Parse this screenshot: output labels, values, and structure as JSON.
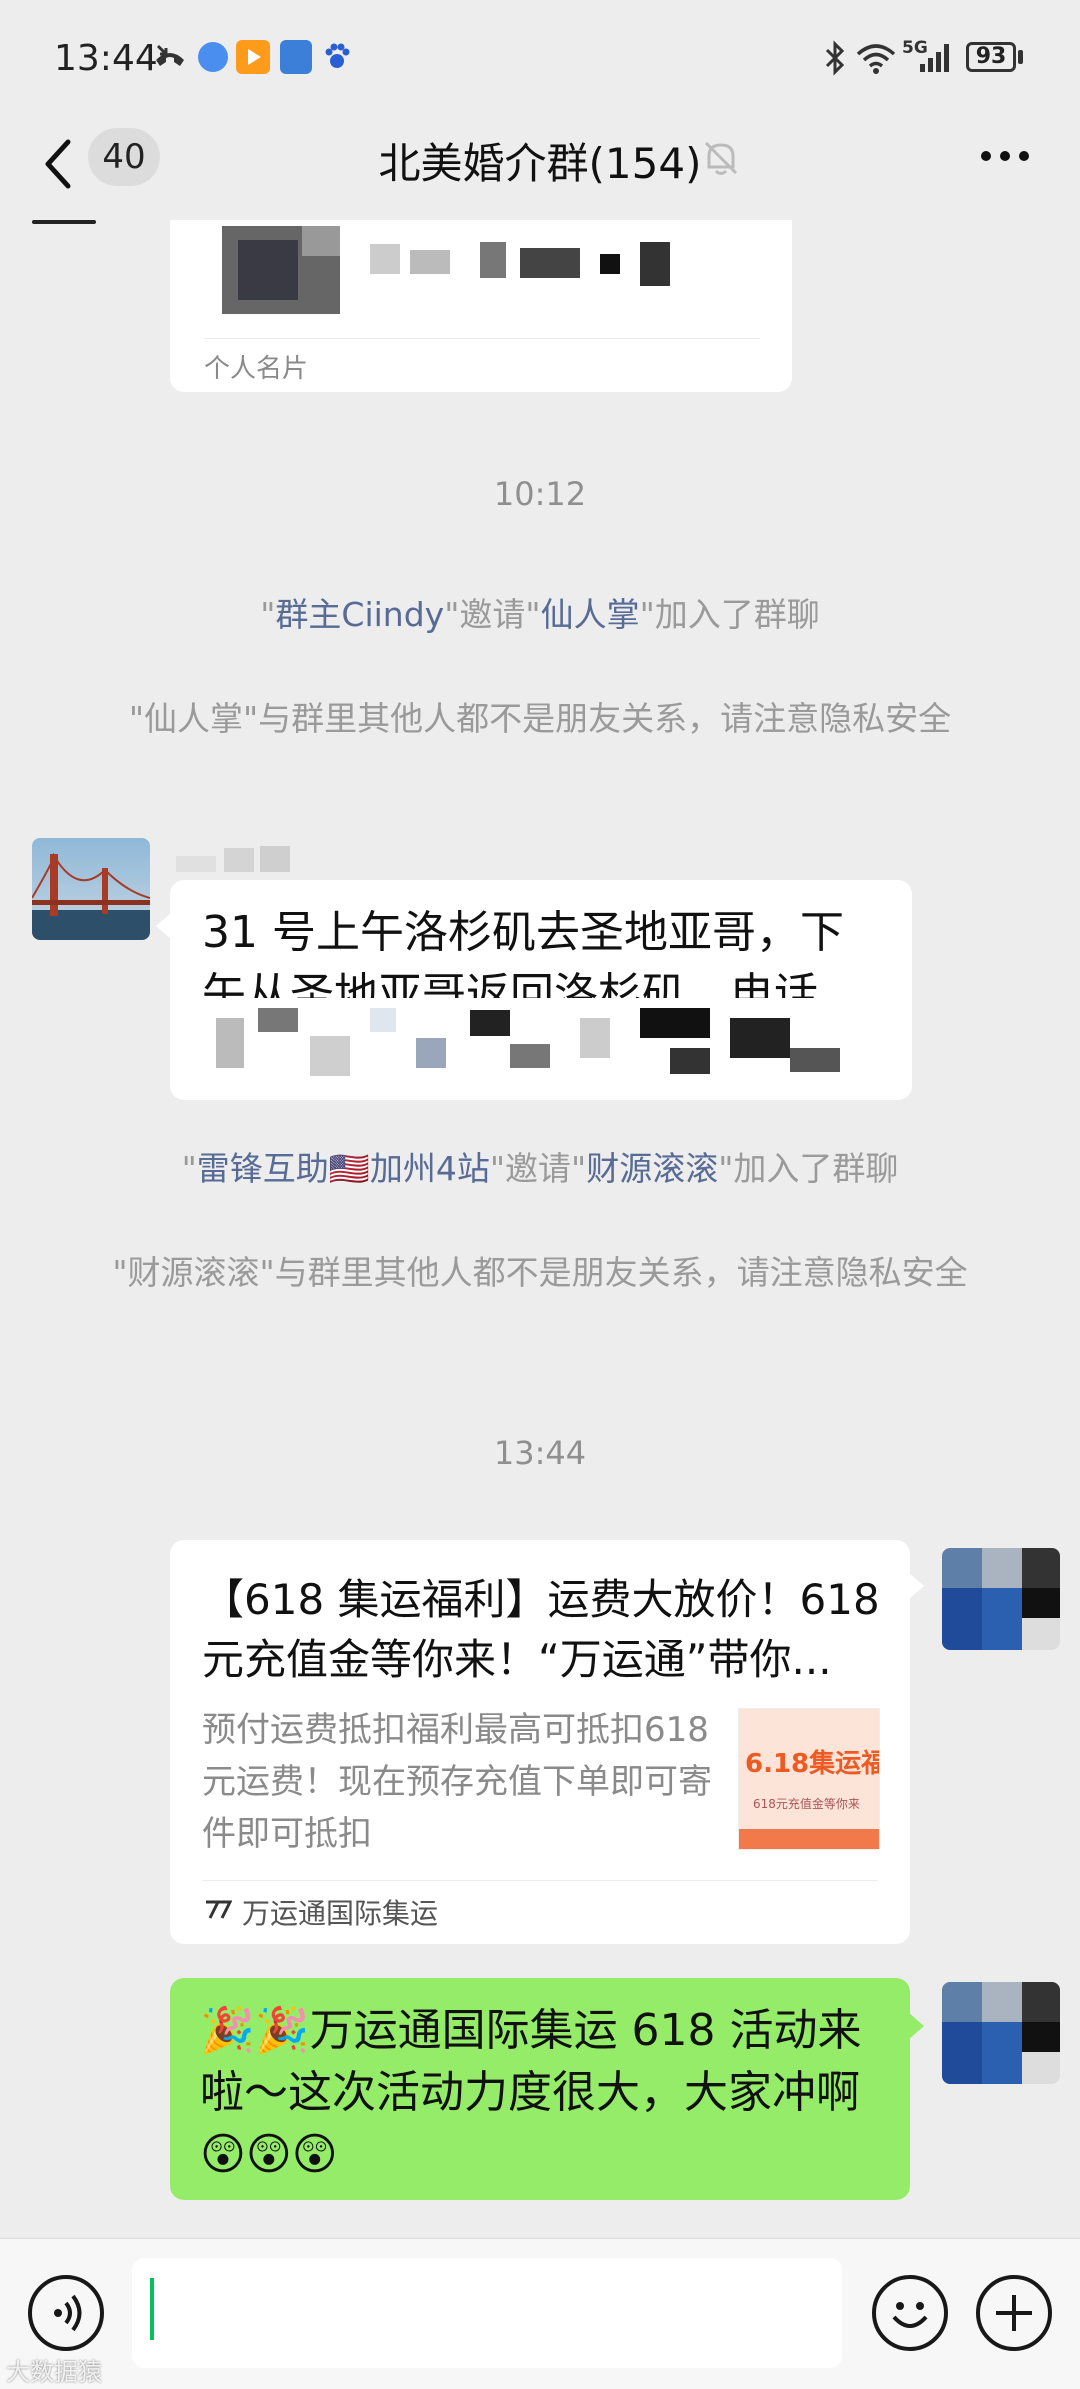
{
  "status_bar": {
    "time": "13:44",
    "network": "5G",
    "battery": "93"
  },
  "nav": {
    "unread_count": "40",
    "title": "北美婚介群(154)"
  },
  "card": {
    "label": "个人名片"
  },
  "timestamps": [
    "10:12",
    "13:44"
  ],
  "system_messages": [
    {
      "q1": "\"",
      "inviter": "群主Ciindy",
      "mid": "\"邀请\"",
      "invitee": "仙人掌",
      "end": "\"加入了群聊"
    },
    {
      "text": "\"仙人掌\"与群里其他人都不是朋友关系，请注意隐私安全"
    },
    {
      "q1": "\"",
      "inviter": "雷锋互助🇺🇸加州4站",
      "mid": "\"邀请\"",
      "invitee": "财源滚滚",
      "end": "\"加入了群聊"
    },
    {
      "text": "\"财源滚滚\"与群里其他人都不是朋友关系，请注意隐私安全"
    }
  ],
  "messages": {
    "ride": {
      "line1": "31 号上午洛杉矶去圣地亚哥，下",
      "line2": "午从圣地亚哥返回洛杉矶，电话"
    },
    "link_card": {
      "title": "【618 集运福利】运费大放价！618 元充值金等你来！“万运通”带你...",
      "desc": "预付运费抵扣福利最高可抵扣618元运费！现在预存充值下单即可寄件即可抵扣",
      "thumb_text": "6.18集运福",
      "thumb_sub": "618元充值金等你来",
      "source": "万运通国际集运"
    },
    "promo": {
      "text": "🎉🎉万运通国际集运 618 活动来啦～这次活动力度很大，大家冲啊😲😲😲"
    }
  },
  "watermark": "大数据猿",
  "colors": {
    "background": "#ededed",
    "self_bubble": "#95ec69",
    "link_blue": "#576b95",
    "input_caret": "#07c160"
  }
}
